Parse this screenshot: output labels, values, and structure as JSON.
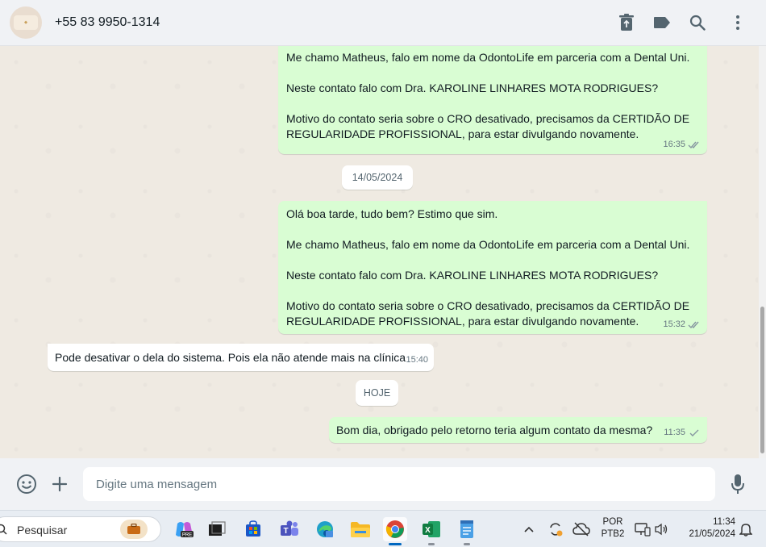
{
  "header": {
    "contact_name": "+55 83 9950-1314",
    "icons": [
      "delete-icon",
      "label-icon",
      "search-icon",
      "menu-icon"
    ]
  },
  "messages": [
    {
      "direction": "out",
      "text": "Me chamo Matheus, falo em nome da OdontoLife em parceria com a Dental Uni.\n\nNeste contato falo com Dra. KAROLINE LINHARES MOTA RODRIGUES?\n\nMotivo do contato seria sobre o CRO desativado, precisamos da CERTIDÃO DE REGULARIDADE PROFISSIONAL, para estar divulgando novamente.",
      "time": "16:35",
      "status": "read"
    },
    {
      "direction": "out",
      "text": "Olá boa tarde, tudo bem? Estimo que sim.\n\nMe chamo Matheus, falo em nome da OdontoLife em parceria com a Dental Uni.\n\nNeste contato falo com Dra. KAROLINE LINHARES MOTA RODRIGUES?\n\nMotivo do contato seria sobre o CRO desativado, precisamos da CERTIDÃO DE REGULARIDADE PROFISSIONAL, para estar divulgando novamente.",
      "time": "15:32",
      "status": "read"
    },
    {
      "direction": "in",
      "text": "Pode desativar o dela do sistema. Pois ela não atende mais na clínica",
      "time": "15:40"
    },
    {
      "direction": "out",
      "text": "Bom dia, obrigado pelo retorno teria algum contato da mesma?",
      "time": "11:35",
      "status": "sent"
    }
  ],
  "date_separators": [
    "14/05/2024",
    "HOJE"
  ],
  "composer": {
    "placeholder": "Digite uma mensagem"
  },
  "taskbar": {
    "search_placeholder": "Pesquisar",
    "language": "POR",
    "layout": "PTB2",
    "time": "11:34",
    "date": "21/05/2024"
  },
  "colors": {
    "outgoing_bubble": "#d9fdd3",
    "incoming_bubble": "#ffffff",
    "chat_background": "#efeae2",
    "read_tick": "#53bdeb"
  }
}
